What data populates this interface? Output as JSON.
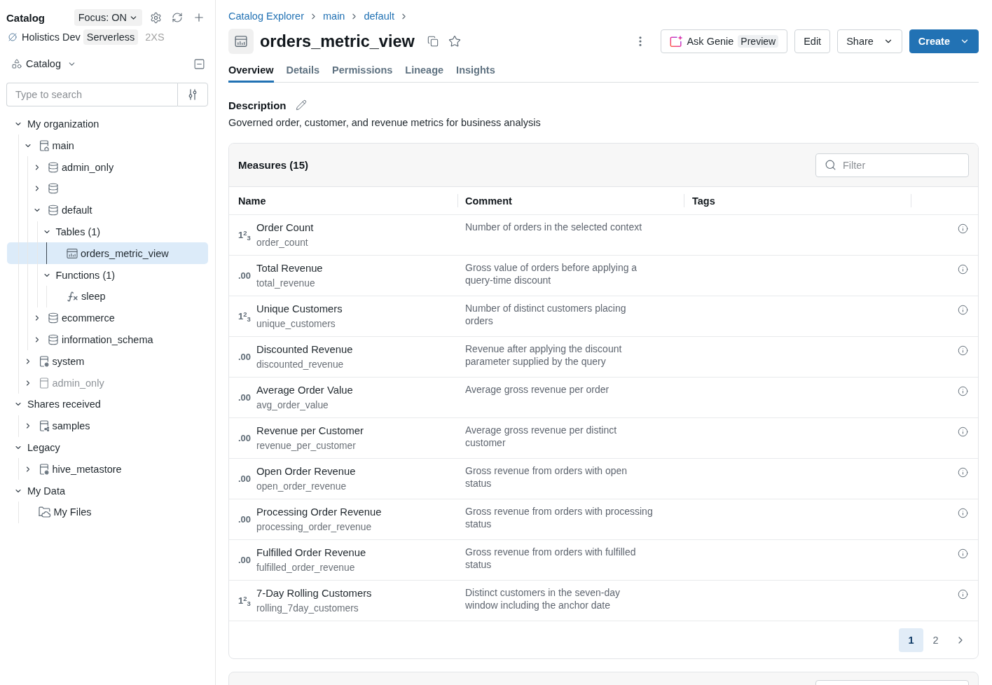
{
  "sidebar": {
    "title": "Catalog",
    "focus_dropdown": "Focus: ON",
    "compute": {
      "name": "Holistics Dev",
      "type": "Serverless",
      "size": "2XS"
    },
    "catalog_selector": "Catalog",
    "search": {
      "placeholder": "Type to search"
    },
    "tree": [
      {
        "label": "My organization",
        "kind": "plain",
        "expanded": true,
        "selected": false,
        "disabled": false,
        "children": [
          {
            "label": "main",
            "kind": "workspace",
            "expanded": true,
            "selected": false,
            "disabled": false,
            "children": [
              {
                "label": "admin_only",
                "kind": "schema",
                "expanded": false,
                "selected": false,
                "disabled": false
              },
              {
                "kind": "schema",
                "expanded": false,
                "selected": false,
                "disabled": false
              },
              {
                "label": "default",
                "kind": "schema",
                "expanded": true,
                "selected": false,
                "disabled": false,
                "children": [
                  {
                    "label": "Tables (1)",
                    "kind": "plain",
                    "expanded": true,
                    "selected": false,
                    "disabled": false,
                    "children": [
                      {
                        "label": "orders_metric_view",
                        "kind": "metricview",
                        "selected": true,
                        "disabled": false
                      }
                    ]
                  },
                  {
                    "label": "Functions (1)",
                    "kind": "plain",
                    "expanded": true,
                    "selected": false,
                    "disabled": false,
                    "children": [
                      {
                        "label": "sleep",
                        "kind": "function",
                        "selected": false,
                        "disabled": false
                      }
                    ]
                  }
                ]
              },
              {
                "label": "ecommerce",
                "kind": "schema",
                "expanded": false,
                "selected": false,
                "disabled": false
              },
              {
                "label": "information_schema",
                "kind": "schema",
                "expanded": false,
                "selected": false,
                "disabled": false
              }
            ]
          },
          {
            "label": "system",
            "kind": "system",
            "expanded": false,
            "selected": false,
            "disabled": false
          },
          {
            "label": "admin_only",
            "kind": "catalog",
            "expanded": false,
            "selected": false,
            "disabled": true
          }
        ]
      },
      {
        "label": "Shares received",
        "kind": "plain",
        "expanded": true,
        "selected": false,
        "disabled": false,
        "children": [
          {
            "label": "samples",
            "kind": "shared",
            "expanded": false,
            "selected": false,
            "disabled": false
          }
        ]
      },
      {
        "label": "Legacy",
        "kind": "plain",
        "expanded": true,
        "selected": false,
        "disabled": false,
        "children": [
          {
            "label": "hive_metastore",
            "kind": "system",
            "expanded": false,
            "selected": false,
            "disabled": false
          }
        ]
      },
      {
        "label": "My Data",
        "kind": "plain",
        "expanded": true,
        "selected": false,
        "disabled": false,
        "children": [
          {
            "label": "My Files",
            "kind": "files",
            "selected": false,
            "disabled": false
          }
        ]
      }
    ]
  },
  "breadcrumbs": [
    "Catalog Explorer",
    "main",
    "default"
  ],
  "title": "orders_metric_view",
  "actions": [
    {
      "kind": "genie",
      "label": "Ask Genie",
      "badge": "Preview"
    },
    {
      "kind": "plain",
      "label": "Edit"
    },
    {
      "kind": "menu",
      "label": "Share"
    },
    {
      "kind": "primary",
      "label": "Create"
    }
  ],
  "tabs": [
    {
      "label": "Overview",
      "selected": true
    },
    {
      "label": "Details",
      "selected": false
    },
    {
      "label": "Permissions",
      "selected": false
    },
    {
      "label": "Lineage",
      "selected": false
    },
    {
      "label": "Insights",
      "selected": false
    }
  ],
  "description": {
    "heading": "Description",
    "text": "Governed order, customer, and revenue metrics for business analysis"
  },
  "measures": {
    "title": "Measures (15)",
    "filter": {
      "placeholder": "Filter"
    },
    "columns": [
      "Name",
      "Comment",
      "Tags"
    ],
    "rows": [
      {
        "type_symbol": "1$^{2}$$_{3}$",
        "name": "Order Count",
        "key": "order_count",
        "comment": "Number of orders in the selected context"
      },
      {
        "type_symbol": ".00",
        "name": "Total Revenue",
        "key": "total_revenue",
        "comment": "Gross value of orders before applying a query-time discount"
      },
      {
        "type_symbol": "1$^{2}$$_{3}$",
        "name": "Unique Customers",
        "key": "unique_customers",
        "comment": "Number of distinct customers placing orders"
      },
      {
        "type_symbol": ".00",
        "name": "Discounted Revenue",
        "key": "discounted_revenue",
        "comment": "Revenue after applying the discount parameter supplied by the query"
      },
      {
        "type_symbol": ".00",
        "name": "Average Order Value",
        "key": "avg_order_value",
        "comment": "Average gross revenue per order"
      },
      {
        "type_symbol": ".00",
        "name": "Revenue per Customer",
        "key": "revenue_per_customer",
        "comment": "Average gross revenue per distinct customer"
      },
      {
        "type_symbol": ".00",
        "name": "Open Order Revenue",
        "key": "open_order_revenue",
        "comment": "Gross revenue from orders with open status"
      },
      {
        "type_symbol": ".00",
        "name": "Processing Order Revenue",
        "key": "processing_order_revenue",
        "comment": "Gross revenue from orders with processing status"
      },
      {
        "type_symbol": ".00",
        "name": "Fulfilled Order Revenue",
        "key": "fulfilled_order_revenue",
        "comment": "Gross revenue from orders with fulfilled status"
      },
      {
        "type_symbol": "1$^{2}$$_{3}$",
        "name": "7-Day Rolling Customers",
        "key": "rolling_7day_customers",
        "comment": "Distinct customers in the seven-day window including the anchor date"
      }
    ],
    "pagination": {
      "pages": [
        {
          "label": "1",
          "selected": true
        },
        {
          "label": "2",
          "selected": false
        }
      ]
    }
  }
}
